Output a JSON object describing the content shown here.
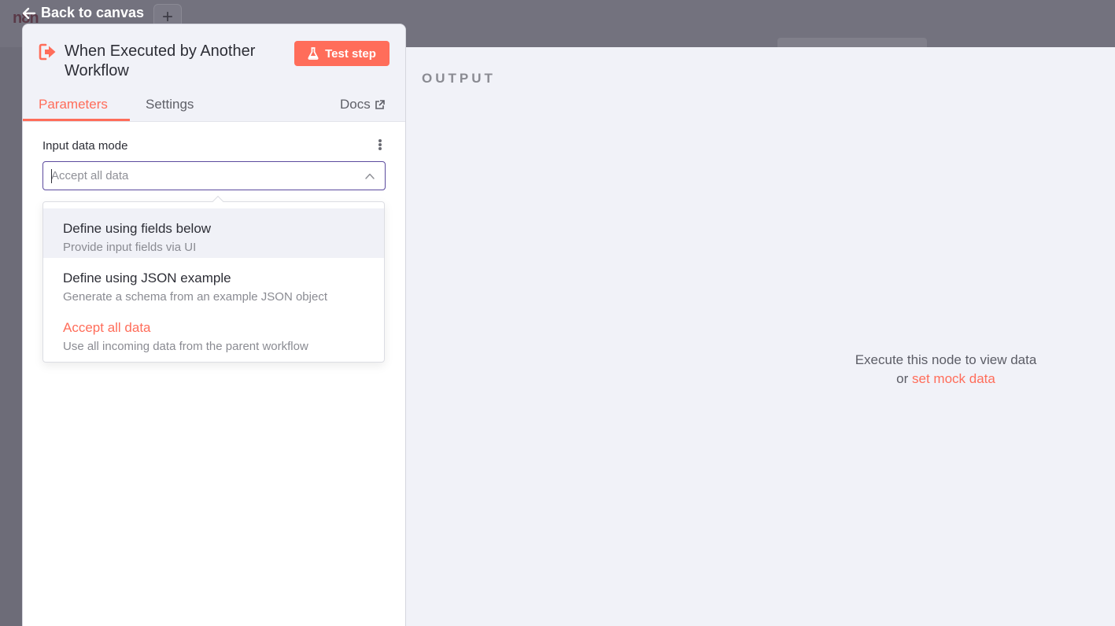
{
  "background": {
    "logo_text": "n8n",
    "add_button": "+"
  },
  "nav": {
    "back_label": "Back to canvas"
  },
  "node": {
    "title": "When Executed by Another Workflow",
    "test_button": "Test step",
    "tabs": [
      {
        "label": "Parameters",
        "active": true
      },
      {
        "label": "Settings",
        "active": false
      }
    ],
    "docs_label": "Docs"
  },
  "parameter": {
    "label": "Input data mode",
    "value": "Accept all data",
    "options": [
      {
        "label": "Define using fields below",
        "description": "Provide input fields via UI",
        "hovered": true,
        "selected": false
      },
      {
        "label": "Define using JSON example",
        "description": "Generate a schema from an example JSON object",
        "hovered": false,
        "selected": false
      },
      {
        "label": "Accept all data",
        "description": "Use all incoming data from the parent workflow",
        "hovered": false,
        "selected": true
      }
    ]
  },
  "output": {
    "title": "OUTPUT",
    "empty_message": "Execute this node to view data",
    "empty_or": "or",
    "mock_link": "set mock data"
  },
  "colors": {
    "accent": "#ff6d5a",
    "focus_border": "#5b4a9e",
    "output_bg": "#f1f2f8"
  }
}
